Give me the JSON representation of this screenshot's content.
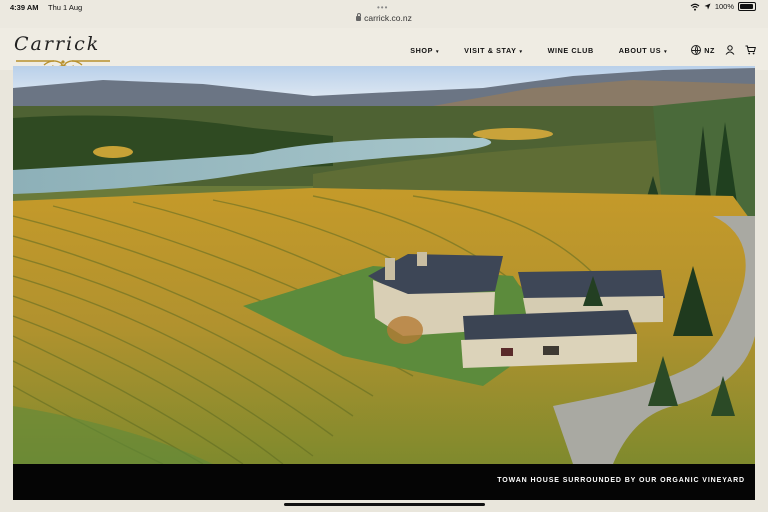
{
  "status_bar": {
    "time": "4:39 AM",
    "date": "Thu 1 Aug",
    "battery": "100%",
    "battery_level": 1.0
  },
  "browser": {
    "url": "carrick.co.nz"
  },
  "site": {
    "logo_text": "Carrick",
    "nav": [
      {
        "label": "SHOP",
        "caret": "▾"
      },
      {
        "label": "VISIT & STAY",
        "caret": "▾"
      },
      {
        "label": "WINE CLUB",
        "caret": ""
      },
      {
        "label": "ABOUT US",
        "caret": "▾"
      }
    ],
    "region": "NZ",
    "icons": {
      "region": "globe-icon",
      "account": "user-icon",
      "cart": "cart-icon"
    }
  },
  "hero": {
    "caption": "TOWAN HOUSE SURROUNDED BY OUR ORGANIC VINEYARD"
  },
  "colors": {
    "header_bg": "#efece3",
    "caption_bg": "#050505",
    "logo_gold": "#b8912e"
  }
}
